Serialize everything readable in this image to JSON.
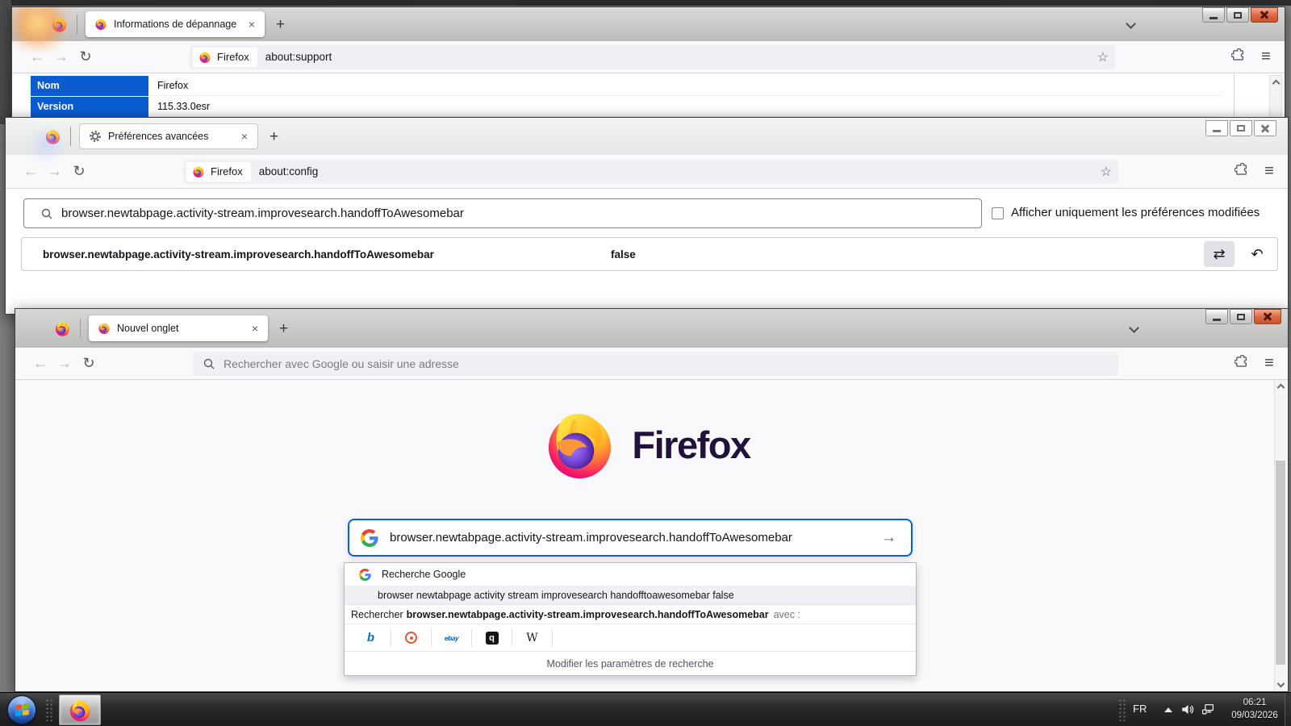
{
  "icons": {
    "back": "←",
    "forward": "→",
    "reload": "↻",
    "star": "☆",
    "menu": "≡",
    "new_tab": "+",
    "close": "×",
    "submit_arrow": "→",
    "toggle": "⇄",
    "undo": "↶",
    "bing_letter": "b",
    "ebay_label": "ebay",
    "qwant_letter": "q",
    "wikipedia_letter": "W"
  },
  "windows": {
    "support": {
      "tab_title": "Informations de dépannage",
      "identity_chip": "Firefox",
      "url": "about:support",
      "table": {
        "rows": [
          {
            "label": "Nom",
            "value": "Firefox"
          },
          {
            "label": "Version",
            "value": "115.33.0esr"
          }
        ]
      }
    },
    "config": {
      "tab_title": "Préférences avancées",
      "identity_chip": "Firefox",
      "url": "about:config",
      "search_value": "browser.newtabpage.activity-stream.improvesearch.handoffToAwesomebar",
      "show_modified_label": "Afficher uniquement les préférences modifiées",
      "show_modified_checked": false,
      "pref_name": "browser.newtabpage.activity-stream.improvesearch.handoffToAwesomebar",
      "pref_value": "false"
    },
    "newtab": {
      "tab_title": "Nouvel onglet",
      "urlbar_placeholder": "Rechercher avec Google ou saisir une adresse",
      "wordmark": "Firefox",
      "search_value": "browser.newtabpage.activity-stream.improvesearch.handoffToAwesomebar",
      "dropdown": {
        "header_label": "Recherche Google",
        "suggestion": "browser newtabpage activity stream improvesearch handofftoawesomebar false",
        "rechercher_prefix": "Rechercher",
        "rechercher_term": "browser.newtabpage.activity-stream.improvesearch.handoffToAwesomebar",
        "rechercher_suffix": "avec :",
        "engines": [
          "bing",
          "duckduckgo",
          "ebay",
          "qwant",
          "wikipedia"
        ],
        "footer": "Modifier les paramètres de recherche"
      }
    }
  },
  "taskbar": {
    "language": "FR",
    "time": "06:21",
    "date": "09/03/2026"
  },
  "colors": {
    "table_header_blue": "#0c5cd1",
    "urlbar_focus_blue": "#0061e0",
    "close_button_red": "#dd6a44"
  }
}
